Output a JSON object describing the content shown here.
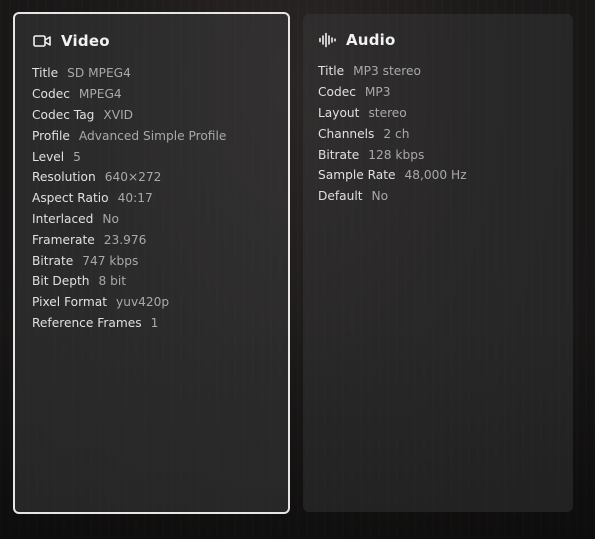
{
  "video": {
    "title": "Video",
    "icon": "video-camera-icon",
    "rows": [
      {
        "key": "Title",
        "value": "SD MPEG4"
      },
      {
        "key": "Codec",
        "value": "MPEG4"
      },
      {
        "key": "Codec Tag",
        "value": "XVID"
      },
      {
        "key": "Profile",
        "value": "Advanced Simple Profile"
      },
      {
        "key": "Level",
        "value": "5"
      },
      {
        "key": "Resolution",
        "value": "640×272"
      },
      {
        "key": "Aspect Ratio",
        "value": "40:17"
      },
      {
        "key": "Interlaced",
        "value": "No"
      },
      {
        "key": "Framerate",
        "value": "23.976"
      },
      {
        "key": "Bitrate",
        "value": "747 kbps"
      },
      {
        "key": "Bit Depth",
        "value": "8 bit"
      },
      {
        "key": "Pixel Format",
        "value": "yuv420p"
      },
      {
        "key": "Reference Frames",
        "value": "1"
      }
    ]
  },
  "audio": {
    "title": "Audio",
    "icon": "audio-waveform-icon",
    "rows": [
      {
        "key": "Title",
        "value": "MP3 stereo"
      },
      {
        "key": "Codec",
        "value": "MP3"
      },
      {
        "key": "Layout",
        "value": "stereo"
      },
      {
        "key": "Channels",
        "value": "2 ch"
      },
      {
        "key": "Bitrate",
        "value": "128 kbps"
      },
      {
        "key": "Sample Rate",
        "value": "48,000 Hz"
      },
      {
        "key": "Default",
        "value": "No"
      }
    ]
  },
  "colors": {
    "focus_border": "#e6e6e6",
    "label": "#e0e0e0",
    "value": "#a9a9a9"
  }
}
